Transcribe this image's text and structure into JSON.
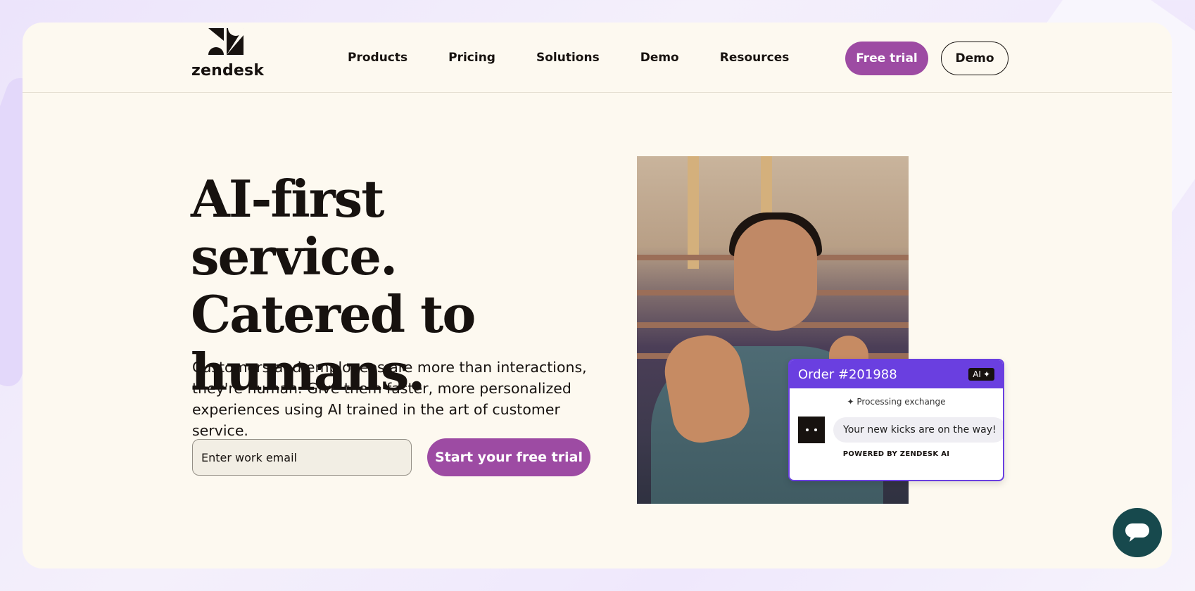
{
  "brand": {
    "logo_text": "zendesk"
  },
  "nav": {
    "items": [
      {
        "label": "Products"
      },
      {
        "label": "Pricing"
      },
      {
        "label": "Solutions"
      },
      {
        "label": "Demo"
      },
      {
        "label": "Resources"
      }
    ],
    "free_trial_label": "Free trial",
    "demo_label": "Demo"
  },
  "hero": {
    "headline_lines": [
      "AI-first service.",
      "Catered to",
      "humans."
    ],
    "subtext": "Customers and employees are more than interactions, they're human. Give them faster, more personalized experiences using AI trained in the art of customer service.",
    "email_placeholder": "Enter work email",
    "cta_label": "Start your free trial"
  },
  "chat_widget": {
    "order_title": "Order #201988",
    "ai_badge": "AI",
    "status": "Processing exchange",
    "message": "Your new kicks are on the way!",
    "powered_by": "POWERED BY ZENDESK AI"
  },
  "colors": {
    "accent": "#9d4ba3",
    "card_bg": "#fdf9f0",
    "chat_accent": "#6a3fe0",
    "fab": "#17494d"
  },
  "icons": {
    "logo": "zendesk-logo-icon",
    "sparkle": "sparkle-icon",
    "chat_fab": "chat-bubble-icon"
  }
}
